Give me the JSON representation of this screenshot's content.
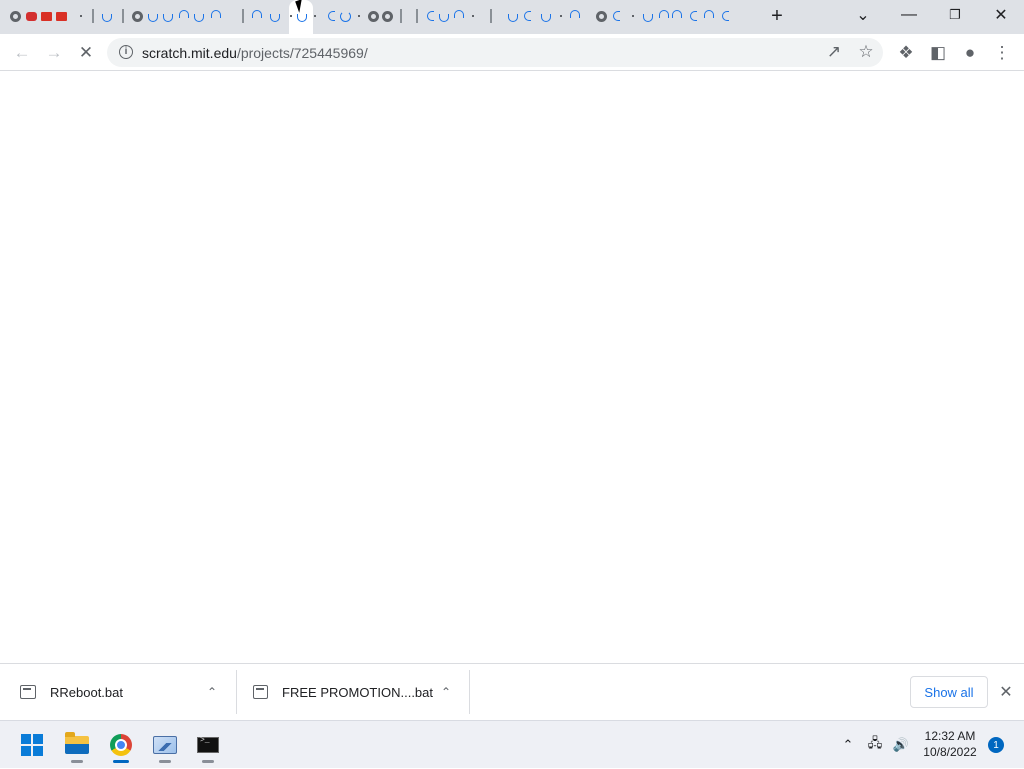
{
  "browser": {
    "url_host": "scratch.mit.edu",
    "url_path": "/projects/725445969/",
    "window_controls": {
      "minimize": "—",
      "restore": "❐",
      "close": "✕",
      "tab_search": "⌄"
    }
  },
  "downloads": {
    "items": [
      {
        "name": "RReboot.bat"
      },
      {
        "name": "FREE PROMOTION....bat"
      }
    ],
    "show_all_label": "Show all"
  },
  "taskbar": {
    "time": "12:32 AM",
    "date": "10/8/2022",
    "notification_count": "1"
  }
}
